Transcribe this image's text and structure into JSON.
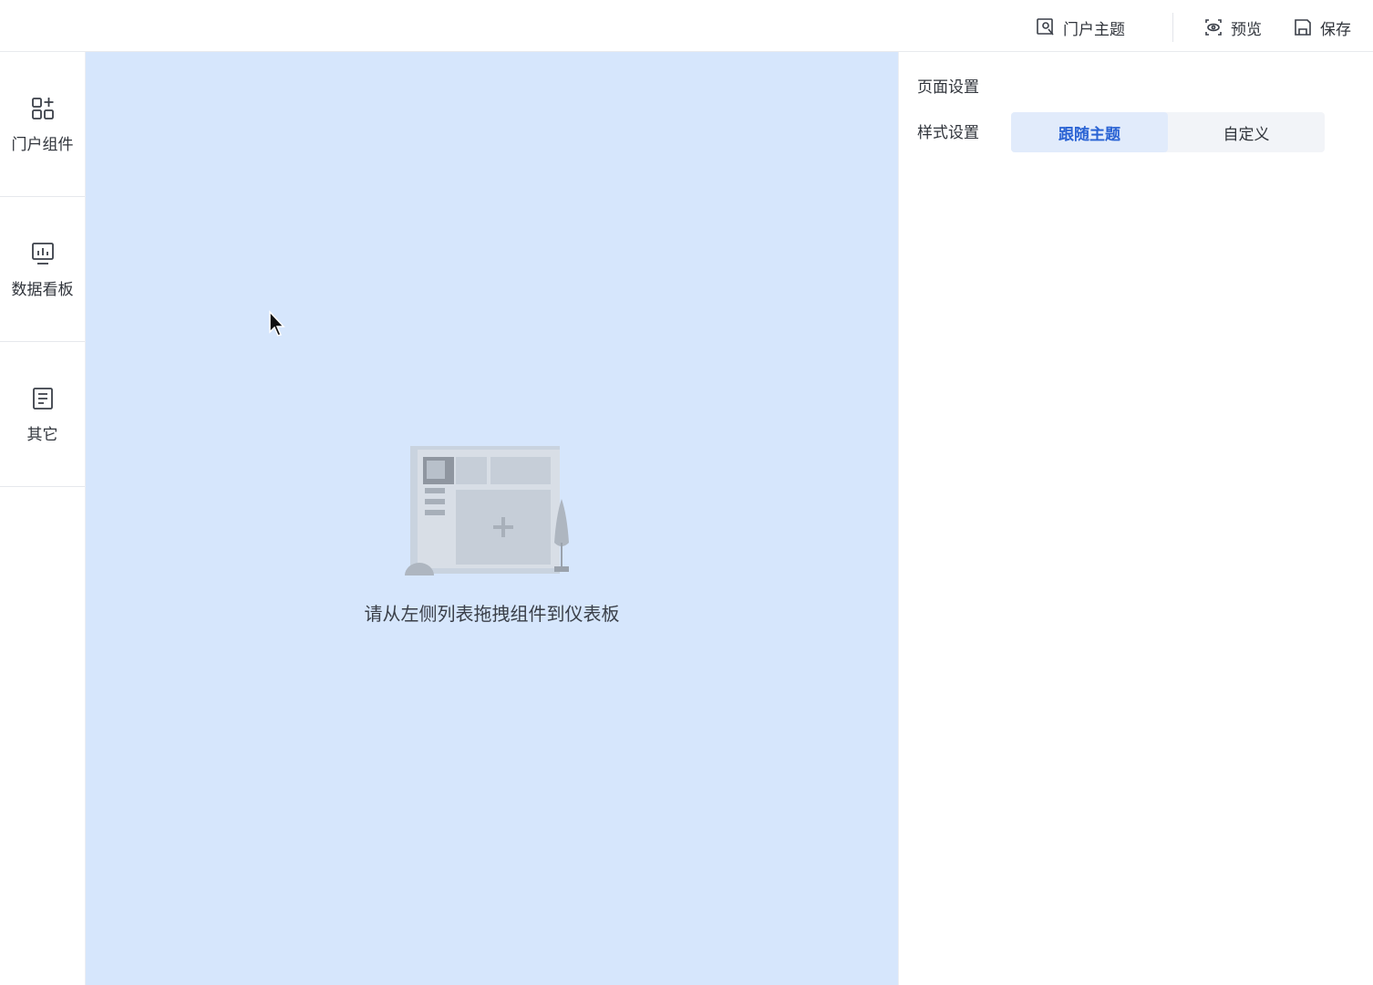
{
  "topbar": {
    "theme_label": "门户主题",
    "preview_label": "预览",
    "save_label": "保存"
  },
  "sidebar": {
    "items": [
      {
        "label": "门户组件",
        "icon": "widgets-add-icon"
      },
      {
        "label": "数据看板",
        "icon": "dashboard-chart-icon"
      },
      {
        "label": "其它",
        "icon": "document-icon"
      }
    ]
  },
  "canvas": {
    "empty_text": "请从左侧列表拖拽组件到仪表板"
  },
  "right_panel": {
    "title": "页面设置",
    "style_label": "样式设置",
    "options": [
      "跟随主题",
      "自定义"
    ],
    "selected": "跟随主题"
  },
  "colors": {
    "canvas_bg": "#d6e6fc",
    "accent": "#2a63d4",
    "segment_active_bg": "#e1ebfb"
  }
}
